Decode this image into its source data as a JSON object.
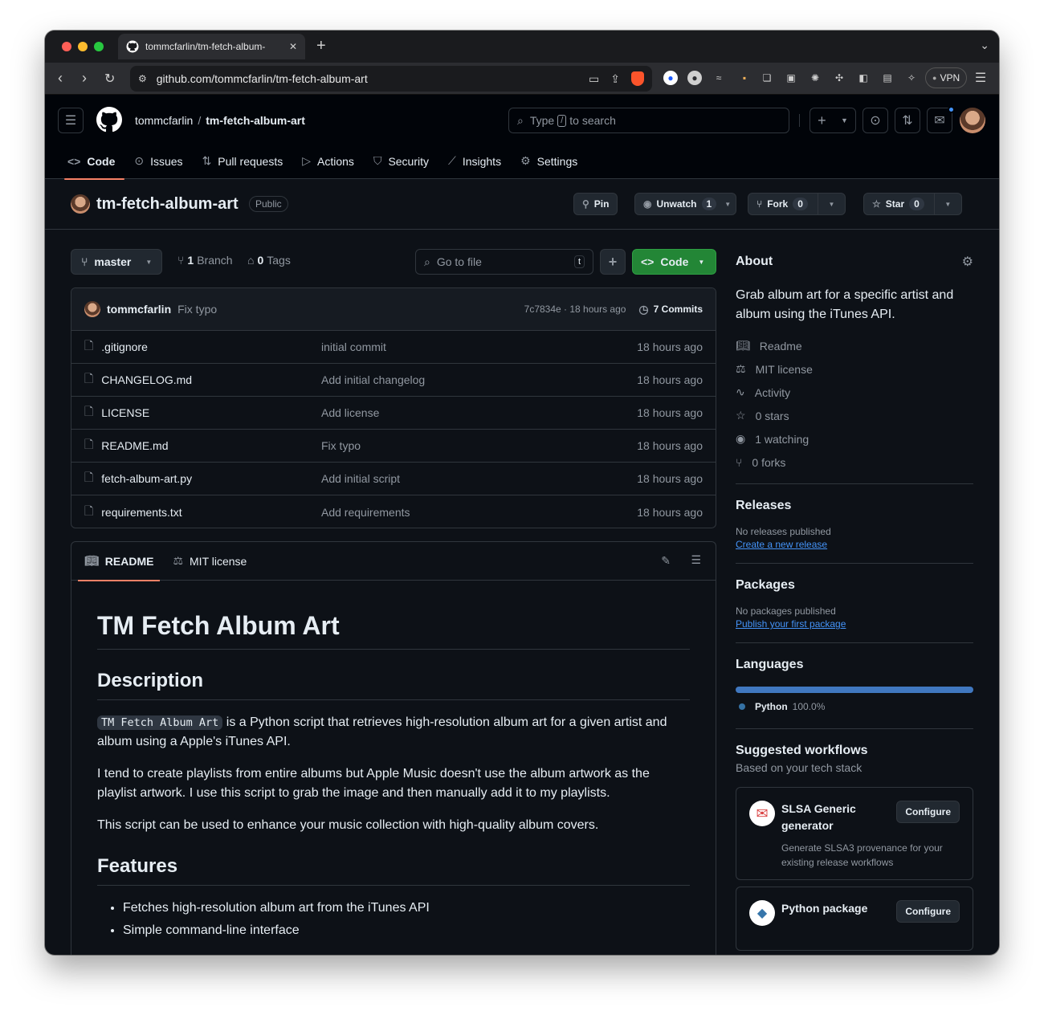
{
  "browser": {
    "tab_title": "tommcfarlin/tm-fetch-album-",
    "url": "github.com/tommcfarlin/tm-fetch-album-art",
    "vpn_label": "VPN"
  },
  "header": {
    "owner": "tommcfarlin",
    "separator": "/",
    "repo": "tm-fetch-album-art",
    "search_prefix": "Type",
    "search_key": "/",
    "search_suffix": "to search"
  },
  "repo_tabs": [
    {
      "label": "Code",
      "icon": "code-icon"
    },
    {
      "label": "Issues",
      "icon": "issue-icon"
    },
    {
      "label": "Pull requests",
      "icon": "pull-request-icon"
    },
    {
      "label": "Actions",
      "icon": "play-icon"
    },
    {
      "label": "Security",
      "icon": "shield-icon"
    },
    {
      "label": "Insights",
      "icon": "graph-icon"
    },
    {
      "label": "Settings",
      "icon": "gear-icon"
    }
  ],
  "repo_header": {
    "name": "tm-fetch-album-art",
    "visibility": "Public",
    "pin": "Pin",
    "unwatch": "Unwatch",
    "unwatch_count": "1",
    "fork": "Fork",
    "fork_count": "0",
    "star": "Star",
    "star_count": "0"
  },
  "toolbar": {
    "branch": "master",
    "branches_count": "1",
    "branches_label": "Branch",
    "tags_count": "0",
    "tags_label": "Tags",
    "goto_placeholder": "Go to file",
    "goto_key": "t",
    "code_button": "Code"
  },
  "latest_commit": {
    "author": "tommcfarlin",
    "message": "Fix typo",
    "hash_time": "7c7834e · 18 hours ago",
    "commits": "7 Commits"
  },
  "files": [
    {
      "name": ".gitignore",
      "message": "initial commit",
      "time": "18 hours ago"
    },
    {
      "name": "CHANGELOG.md",
      "message": "Add initial changelog",
      "time": "18 hours ago"
    },
    {
      "name": "LICENSE",
      "message": "Add license",
      "time": "18 hours ago"
    },
    {
      "name": "README.md",
      "message": "Fix typo",
      "time": "18 hours ago"
    },
    {
      "name": "fetch-album-art.py",
      "message": "Add initial script",
      "time": "18 hours ago"
    },
    {
      "name": "requirements.txt",
      "message": "Add requirements",
      "time": "18 hours ago"
    }
  ],
  "readme": {
    "tab_readme": "README",
    "tab_license": "MIT license",
    "h1": "TM Fetch Album Art",
    "h2_description": "Description",
    "p1_code": "TM Fetch Album Art",
    "p1_rest": " is a Python script that retrieves high-resolution album art for a given artist and album using a Apple's iTunes API.",
    "p2": "I tend to create playlists from entire albums but Apple Music doesn't use the album artwork as the playlist artwork. I use this script to grab the image and then manually add it to my playlists.",
    "p3": "This script can be used to enhance your music collection with high-quality album covers.",
    "h2_features": "Features",
    "features": [
      "Fetches high-resolution album art from the iTunes API",
      "Simple command-line interface"
    ]
  },
  "about": {
    "title": "About",
    "description": "Grab album art for a specific artist and album using the iTunes API.",
    "links": [
      {
        "label": "Readme",
        "icon": "book-icon"
      },
      {
        "label": "MIT license",
        "icon": "law-icon"
      },
      {
        "label": "Activity",
        "icon": "pulse-icon"
      },
      {
        "label": "0 stars",
        "icon": "star-icon"
      },
      {
        "label": "1 watching",
        "icon": "eye-icon"
      },
      {
        "label": "0 forks",
        "icon": "fork-icon"
      }
    ]
  },
  "releases": {
    "title": "Releases",
    "none": "No releases published",
    "link": "Create a new release"
  },
  "packages": {
    "title": "Packages",
    "none": "No packages published",
    "link": "Publish your first package"
  },
  "languages": {
    "title": "Languages",
    "name": "Python",
    "percent": "100.0%",
    "color": "#3572A5",
    "bar_color": "#4078c0"
  },
  "workflows": {
    "title": "Suggested workflows",
    "subtitle": "Based on your tech stack",
    "items": [
      {
        "name": "SLSA Generic generator",
        "desc": "Generate SLSA3 provenance for your existing release workflows",
        "button": "Configure"
      },
      {
        "name": "Python package",
        "desc": "",
        "button": "Configure"
      }
    ]
  },
  "colors": {
    "accent_tab": "#f78166",
    "green_button": "#238636",
    "link": "#4493f8"
  }
}
